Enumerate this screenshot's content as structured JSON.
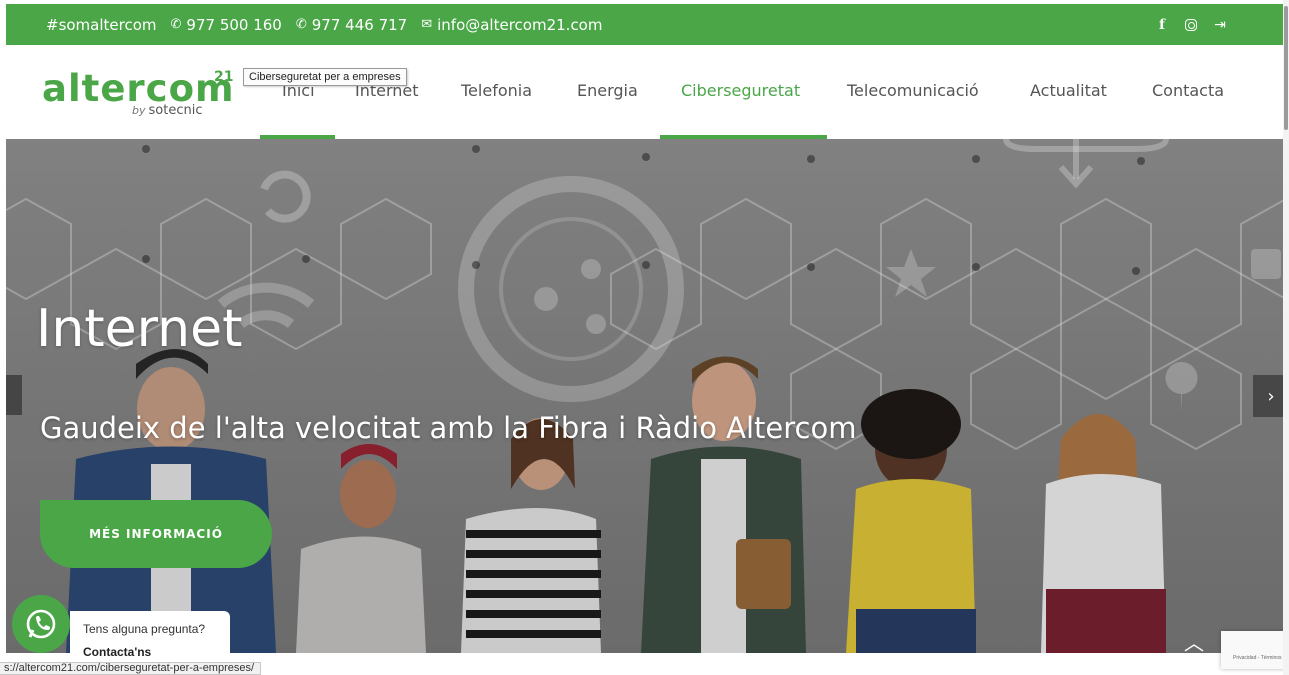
{
  "topbar": {
    "hashtag": "#somaltercom",
    "phone1": "977 500 160",
    "phone2": "977 446 717",
    "email": "info@altercom21.com",
    "social": [
      "facebook-icon",
      "instagram-icon",
      "login-icon"
    ]
  },
  "logo": {
    "word": "altercom",
    "sup": "21",
    "by_prefix": "by",
    "by_brand": "sotecnic"
  },
  "nav": {
    "items": [
      {
        "label": "Inici"
      },
      {
        "label": "Internet"
      },
      {
        "label": "Telefonia"
      },
      {
        "label": "Energia"
      },
      {
        "label": "Ciberseguretat"
      },
      {
        "label": "Telecomunicació"
      },
      {
        "label": "Actualitat"
      },
      {
        "label": "Contacta"
      }
    ],
    "active": "Ciberseguretat",
    "tooltip": "Ciberseguretat per a empreses"
  },
  "hero": {
    "title": "Internet",
    "subtitle": "Gaudeix de l'alta velocitat amb la Fibra i Ràdio Altercom",
    "cta": "MÉS INFORMACIÓ",
    "next_arrow": "›"
  },
  "whatsapp": {
    "question": "Tens alguna pregunta?",
    "contact": "Contacta'ns"
  },
  "status_url": "s://altercom21.com/ciberseguretat-per-a-empreses/",
  "recaptcha": "Privacidad - Términos",
  "colors": {
    "brand_green": "#4aa647",
    "nav_text": "#555555"
  }
}
